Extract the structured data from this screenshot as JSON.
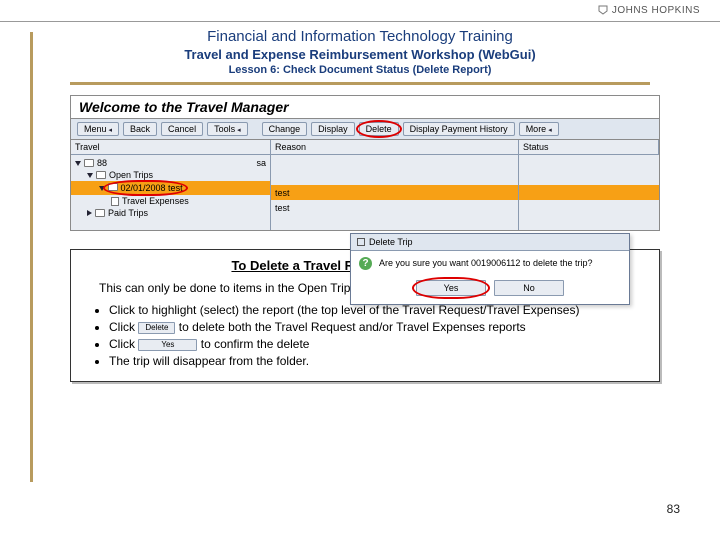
{
  "logo": {
    "text": "JOHNS HOPKINS"
  },
  "header": {
    "line1": "Financial and Information Technology Training",
    "line2": "Travel and Expense Reimbursement Workshop (WebGui)",
    "line3": "Lesson 6: Check Document Status (Delete Report)"
  },
  "app": {
    "title": "Welcome to the Travel Manager",
    "toolbar": {
      "menu": "Menu",
      "back": "Back",
      "cancel": "Cancel",
      "tools": "Tools",
      "change": "Change",
      "display": "Display",
      "delete": "Delete",
      "display_payment_history": "Display Payment History",
      "more": "More"
    },
    "cols": {
      "travel": "Travel",
      "reason": "Reason",
      "status": "Status"
    },
    "tree": {
      "root_prefix": "88",
      "root_suffix": "sa",
      "open_trips": "Open Trips",
      "selected_trip": "02/01/2008 test",
      "travel_expenses": "Travel Expenses",
      "paid_trips": "Paid Trips",
      "reason_sel": "test",
      "reason_child": "test"
    }
  },
  "dialog": {
    "title": "Delete Trip",
    "message": "Are you sure you want 0019006112  to delete the trip?",
    "yes": "Yes",
    "no": "No"
  },
  "instructions": {
    "title": "To Delete a Travel Request/Expense Report",
    "lead": "This can only be done to items in the Open Trips folder.",
    "b1": "Click to highlight (select) the report (the top level of the Travel Request/Travel Expenses)",
    "b2a": "Click ",
    "b2btn": "Delete",
    "b2b": " to delete both the Travel Request and/or Travel Expenses reports",
    "b3a": "Click ",
    "b3btn": "Yes",
    "b3b": " to confirm the delete",
    "b4": "The trip will disappear from the folder."
  },
  "page_number": "83"
}
